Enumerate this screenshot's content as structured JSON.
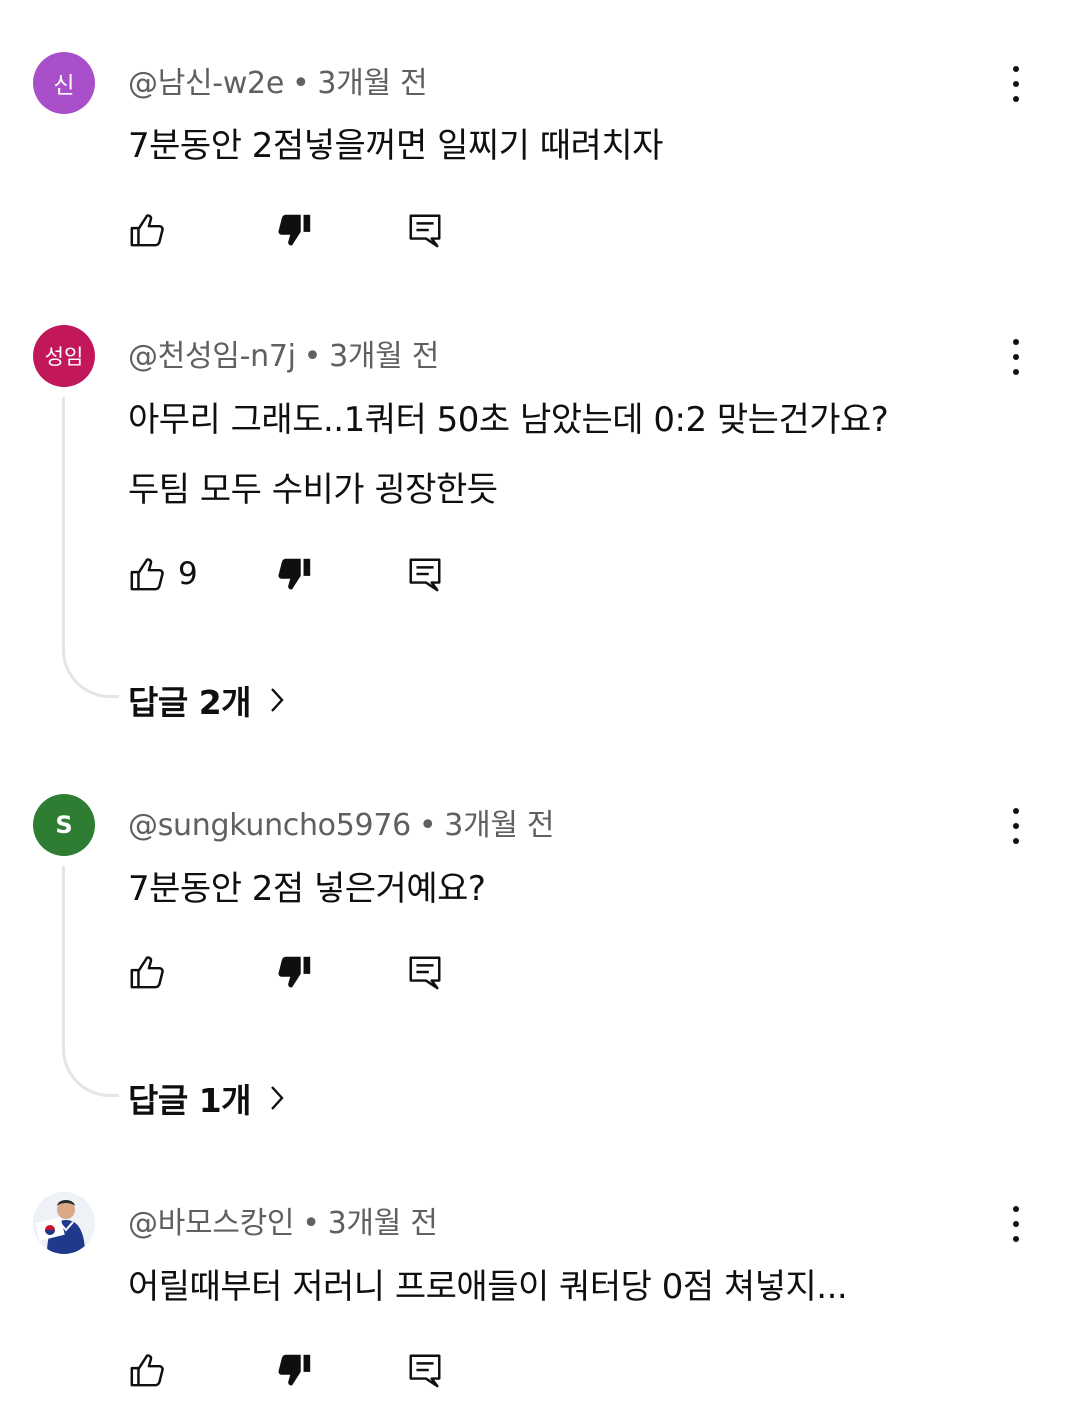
{
  "comments": [
    {
      "avatar_text": "신",
      "avatar_color": "#a94fc9",
      "author": "@남신-w2e",
      "time": "3개월 전",
      "lines": [
        "7분동안 2점넣을꺼면 일찌기 때려치자"
      ],
      "likes": ""
    },
    {
      "avatar_text": "성임",
      "avatar_color": "#c2185b",
      "author": "@천성임-n7j",
      "time": "3개월 전",
      "lines": [
        "아무리 그래도..1쿼터 50초 남았는데  0:2 맞는건가요?",
        "두팀 모두 수비가 굉장한듯"
      ],
      "likes": "9",
      "replies": "답글 2개"
    },
    {
      "avatar_text": "S",
      "avatar_color": "#2e7d32",
      "author": "@sungkuncho5976",
      "time": "3개월 전",
      "lines": [
        "7분동안 2점 넣은거예요?"
      ],
      "likes": "",
      "replies": "답글 1개"
    },
    {
      "avatar_text": "",
      "avatar_color": "#e9eef5",
      "author": "@바모스캉인",
      "time": "3개월 전",
      "lines": [
        "어릴때부터 저러니 프로애들이 쿼터당 0점 쳐넣지..."
      ],
      "likes": ""
    }
  ],
  "separator": "•",
  "icons": {
    "like": "thumbs-up-outline-icon",
    "dislike": "thumbs-down-filled-icon",
    "reply": "comment-reply-icon",
    "menu": "more-vert-icon",
    "chevron": "chevron-right-icon"
  }
}
